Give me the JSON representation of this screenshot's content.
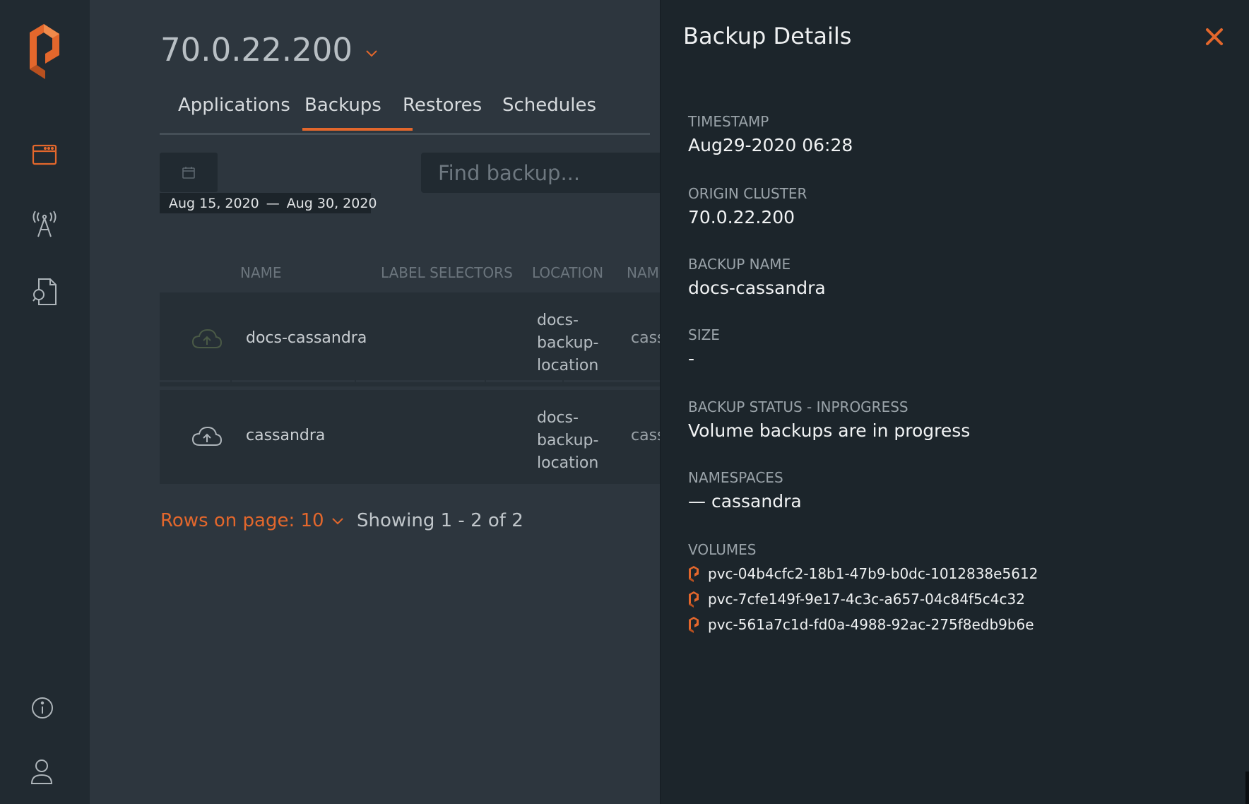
{
  "colors": {
    "accent": "#e3672c",
    "panel_bg": "#1c252b",
    "main_bg": "#2d363e",
    "sidebar_bg": "#212a31"
  },
  "sidebar": {
    "icons": [
      "logo-icon",
      "applications-icon",
      "cluster-icon",
      "docs-icon",
      "info-icon",
      "user-icon"
    ]
  },
  "header": {
    "cluster": "70.0.22.200"
  },
  "tabs": [
    {
      "label": "Applications"
    },
    {
      "label": "Backups",
      "active": true
    },
    {
      "label": "Restores"
    },
    {
      "label": "Schedules"
    }
  ],
  "filter": {
    "date_from": "Aug 15, 2020",
    "date_to": "Aug 30, 2020",
    "separator": "—",
    "search_placeholder": "Find backup..."
  },
  "table": {
    "columns": [
      "NAME",
      "LABEL SELECTORS",
      "LOCATION",
      "NAM"
    ],
    "rows": [
      {
        "name": "docs-cassandra",
        "location_lines": [
          "docs-",
          "backup-",
          "location"
        ],
        "namespace": "cass",
        "status": "in-progress"
      },
      {
        "name": "cassandra",
        "location_lines": [
          "docs-",
          "backup-",
          "location"
        ],
        "namespace": "cass",
        "status": "complete"
      }
    ]
  },
  "pager": {
    "rows_label": "Rows on page: 10",
    "showing": "Showing 1 - 2 of 2"
  },
  "panel": {
    "title": "Backup Details",
    "fields": [
      {
        "label": "TIMESTAMP",
        "value": "Aug29-2020 06:28"
      },
      {
        "label": "ORIGIN CLUSTER",
        "value": "70.0.22.200"
      },
      {
        "label": "BACKUP NAME",
        "value": "docs-cassandra"
      },
      {
        "label": "SIZE",
        "value": "-"
      },
      {
        "label": "BACKUP STATUS - INPROGRESS",
        "value": "Volume backups are in progress"
      },
      {
        "label": "NAMESPACES",
        "value": "— cassandra"
      }
    ],
    "volumes_label": "VOLUMES",
    "volumes": [
      "pvc-04b4cfc2-18b1-47b9-b0dc-1012838e5612",
      "pvc-7cfe149f-9e17-4c3c-a657-04c84f5c4c32",
      "pvc-561a7c1d-fd0a-4988-92ac-275f8edb9b6e"
    ]
  }
}
